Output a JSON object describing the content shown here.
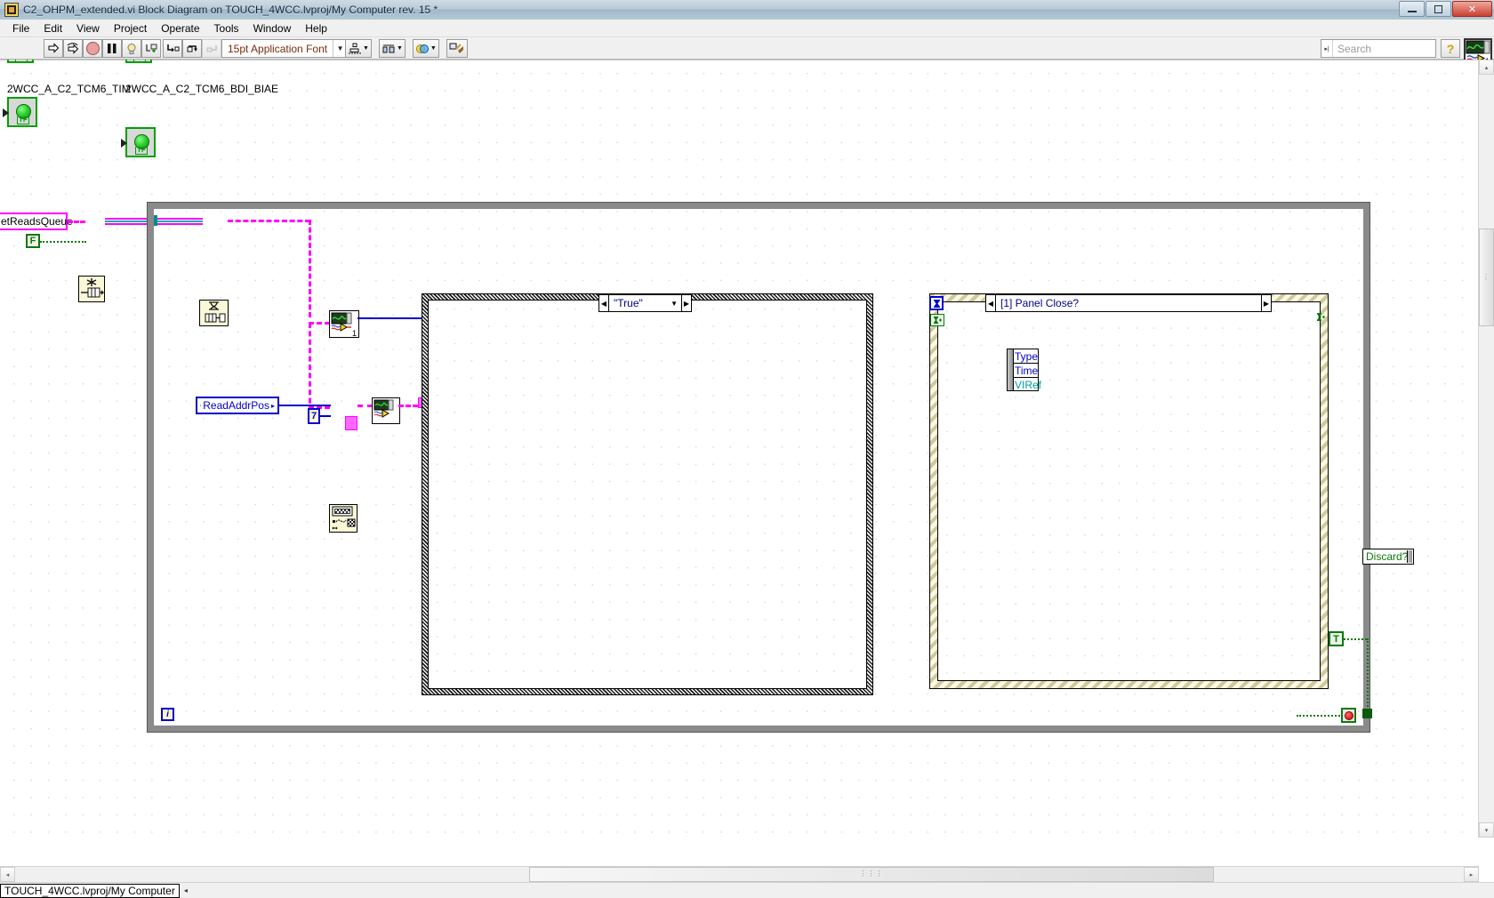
{
  "window": {
    "title": "C2_OHPM_extended.vi Block Diagram on TOUCH_4WCC.lvproj/My Computer rev. 15 *",
    "app_icon": "labview-vi-icon",
    "minimize_label": "Minimize",
    "restore_label": "Restore",
    "close_label": "✕"
  },
  "menu": {
    "items": [
      {
        "label": "File"
      },
      {
        "label": "Edit"
      },
      {
        "label": "View"
      },
      {
        "label": "Project"
      },
      {
        "label": "Operate"
      },
      {
        "label": "Tools"
      },
      {
        "label": "Window"
      },
      {
        "label": "Help"
      }
    ]
  },
  "toolbar": {
    "run_label": "Run",
    "run_continuously_label": "Run Continuously",
    "abort_label": "Abort Execution",
    "pause_label": "Pause",
    "highlight_label": "Highlight Execution",
    "retain_values_label": "Retain Wire Values",
    "step_into_label": "Step Into",
    "step_over_label": "Step Over",
    "step_out_label": "Step Out",
    "font_value": "15pt Application Font",
    "font_dropdown_caret": "▼",
    "align_label": "Align Objects",
    "distribute_label": "Distribute Objects",
    "resize_label": "Resize Objects",
    "reorder_label": "Reorder",
    "cleanup_label": "Clean Up Diagram",
    "help_label": "?",
    "vi_icon_number": "1"
  },
  "search": {
    "placeholder": "Search",
    "pin_glyph": "▸|"
  },
  "statusbar": {
    "target": "TOUCH_4WCC.lvproj/My Computer",
    "collapse_glyph": "◂"
  },
  "scrollbars": {
    "up": "▴",
    "down": "▾",
    "left": "◂",
    "right": "▸",
    "grip": "⋮⋮"
  },
  "diagram": {
    "boolean_indicators": [
      {
        "label": "2WCC_A_C2_TCM6_TIM",
        "type_tag": "TF",
        "state": "true",
        "led_color": "#2fd32f"
      },
      {
        "label": "2WCC_A_C2_TCM6_BDI_BIAE",
        "type_tag": "TF",
        "state": "true",
        "led_color": "#2fd32f"
      }
    ],
    "queue_terminal": {
      "label": "etReadsQueue",
      "wire_color": "#ff00ff"
    },
    "false_constant": {
      "label": "F",
      "color": "#0b7a0b"
    },
    "nodes": [
      {
        "name": "obtain-queue-node",
        "glyph": "✳"
      },
      {
        "name": "dequeue-element-node",
        "glyph": "⧗"
      },
      {
        "name": "subvi-scope-node-1",
        "badge": "1"
      },
      {
        "name": "subvi-array-node",
        "badge": ""
      },
      {
        "name": "subvi-scope-node-2",
        "badge": ""
      }
    ],
    "read_addr_pos_terminal": {
      "label": "ReadAddrPos",
      "icon": "globe-icon",
      "arrow": "▸"
    },
    "index_constant": {
      "label": "7"
    },
    "case_structure": {
      "selector_value": "\"True\"",
      "left_arrow": "◀",
      "right_arrow": "▶",
      "down_arrow": "▼"
    },
    "event_structure": {
      "selector_value": "[1] Panel Close?",
      "left_arrow": "◀",
      "right_arrow": "▶",
      "timeout_glyph": "⏱",
      "hourglass_glyph": "⧖",
      "data_node_rows": [
        {
          "label": "Type",
          "color": "#0000cd"
        },
        {
          "label": "Time",
          "color": "#0000cd"
        },
        {
          "label": "VIRef",
          "color": "#00a0a0"
        }
      ],
      "discard_terminal": {
        "label": "Discard?",
        "color": "#0b7a0b"
      },
      "true_constant": {
        "label": "T",
        "color": "#0b7a0b"
      }
    },
    "while_loop": {
      "iteration_label": "i",
      "stop_label": "stop-terminal"
    }
  }
}
